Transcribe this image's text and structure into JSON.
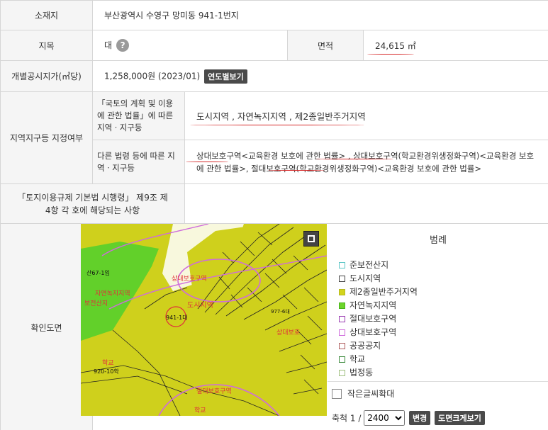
{
  "location": {
    "label": "소재지",
    "value": "부산광역시 수영구 망미동 941-1번지"
  },
  "land_category": {
    "label": "지목",
    "value": "대",
    "help_icon": "?"
  },
  "area": {
    "label": "면적",
    "value": "24,615 ㎡"
  },
  "price": {
    "label": "개별공시지가(㎡당)",
    "value": "1,258,000원 (2023/01)",
    "button": "연도별보기"
  },
  "zoning": {
    "label": "지역지구등 지정여부",
    "sub1_label": "「국토의 계획 및 이용에 관한 법률」에 따른 지역ㆍ지구등",
    "sub1_value": "도시지역 , 자연녹지지역 , 제2종일반주거지역",
    "sub2_label": "다른 법령 등에 따른 지역ㆍ지구등",
    "sub2_value": "상대보호구역<교육환경 보호에 관한 법률> , 상대보호구역(학교환경위생정화구역)<교육환경 보호에 관한 법률>, 절대보호구역(학교환경위생정화구역)<교육환경 보호에 관한 법률>"
  },
  "decree": {
    "label": "「토지이용규제 기본법 시행령」 제9조 제4항 각 호에 해당되는 사항",
    "value": ""
  },
  "map_section": {
    "label": "확인도면",
    "map_labels": {
      "parcel_a": "산67-1임",
      "green_zone": "자연녹지지역",
      "preserved_mountain": "보전산지",
      "relative_zone": "상대보호구역",
      "urban_area": "도시지역",
      "parcel_b": "941-1대",
      "school": "학교",
      "parcel_c": "920-10학",
      "absolute_zone": "절대보호구역",
      "school2": "학교",
      "relative_zone2": "상대보호",
      "parcel_d": "977-6대"
    }
  },
  "legend": {
    "title": "범례",
    "items": [
      {
        "label": "준보전산지",
        "color": "#5cc6c6",
        "fill": "#ffffff"
      },
      {
        "label": "도시지역",
        "color": "#444444",
        "fill": "#ffffff"
      },
      {
        "label": "제2종일반주거지역",
        "color": "#b5b820",
        "fill": "#d3d41c"
      },
      {
        "label": "자연녹지지역",
        "color": "#49b31c",
        "fill": "#6cd42a"
      },
      {
        "label": "절대보호구역",
        "color": "#9b3db2",
        "fill": "#ffffff"
      },
      {
        "label": "상대보호구역",
        "color": "#cf6bdc",
        "fill": "#ffffff"
      },
      {
        "label": "공공공지",
        "color": "#b06060",
        "fill": "#ffffff"
      },
      {
        "label": "학교",
        "color": "#3c8a3c",
        "fill": "#ffffff"
      },
      {
        "label": "법정동",
        "color": "#9fbf7f",
        "fill": "#ffffff"
      }
    ]
  },
  "controls": {
    "enlarge_label": "작은글씨확대",
    "scale_label": "축척 1 /",
    "scale_value": "2400",
    "change_button": "변경",
    "zoom_button": "도면크게보기"
  },
  "colors": {
    "annotation_red": "#d62a2a",
    "map_yellow": "#cfd01c",
    "map_green": "#62d02a"
  }
}
